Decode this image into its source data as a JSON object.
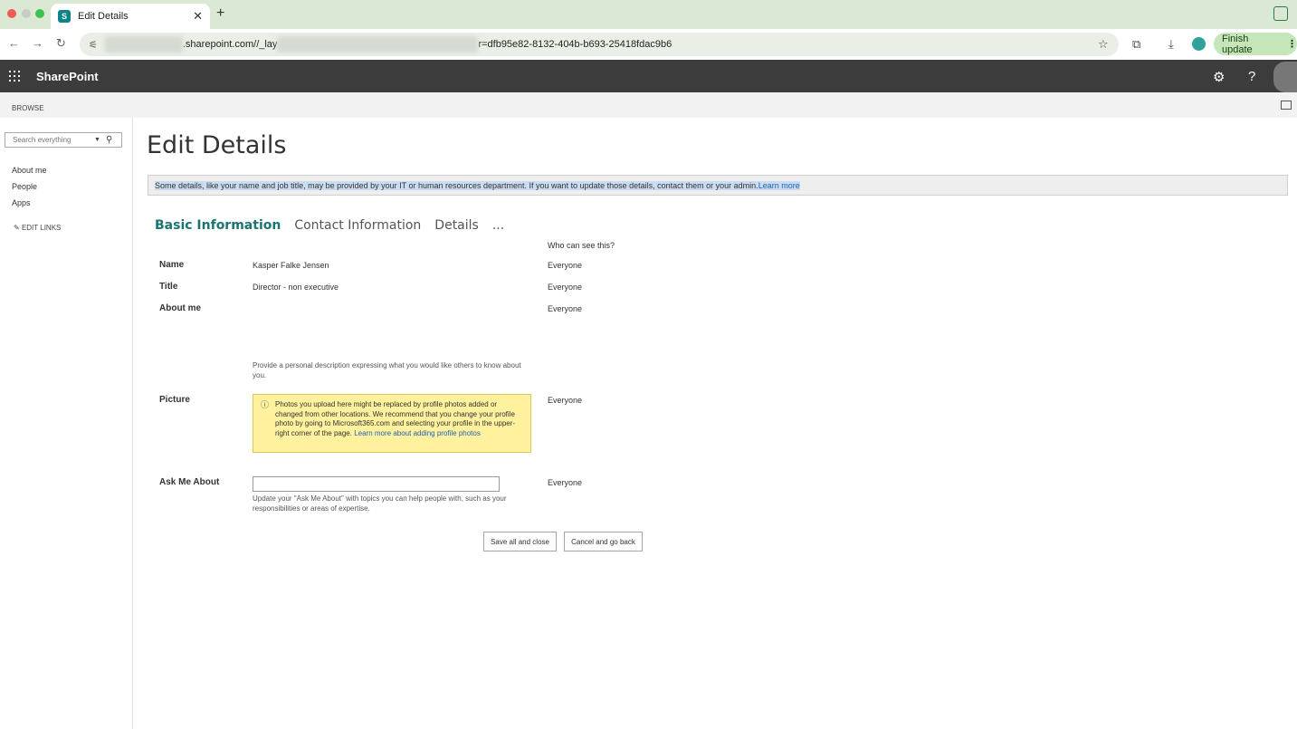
{
  "browser": {
    "tab_title": "Edit Details",
    "tab_favicon_letter": "S",
    "tab_close": "✕",
    "new_tab": "+",
    "url_visible_1": ".sharepoint.com//_lay",
    "url_visible_2": "r=dfb95e82-8132-404b-b693-25418fdac9b6",
    "finish_update": "Finish update",
    "nav_back": "←",
    "nav_forward": "→",
    "reload": "↻"
  },
  "suite": {
    "brand": "SharePoint",
    "settings_glyph": "⚙",
    "help_glyph": "?"
  },
  "ribbon": {
    "browse": "BROWSE"
  },
  "leftnav": {
    "search_placeholder": "Search everything",
    "items": [
      "About me",
      "People",
      "Apps"
    ],
    "edit_links": "EDIT LINKS"
  },
  "main": {
    "title": "Edit Details",
    "info_text": "Some details, like your name and job title, may be provided by your IT or human resources department. If you want to update those details, contact them or your admin.",
    "info_link": "Learn more",
    "tabs": [
      "Basic Information",
      "Contact Information",
      "Details"
    ],
    "tabs_more": "...",
    "who_can_see": "Who can see this?",
    "fields": {
      "name_label": "Name",
      "name_value": "Kasper Falke Jensen",
      "name_privacy": "Everyone",
      "title_label": "Title",
      "title_value": "Director - non executive",
      "title_privacy": "Everyone",
      "about_label": "About me",
      "about_privacy": "Everyone",
      "about_hint": "Provide a personal description expressing what you would like others to know about you.",
      "picture_label": "Picture",
      "picture_privacy": "Everyone",
      "picture_warning": "Photos you upload here might be replaced by profile photos added or changed from other locations. We recommend that you change your profile photo by going to Microsoft365.com and selecting your profile in the upper-right corner of the page.",
      "picture_link": "Learn more about adding profile photos",
      "ask_label": "Ask Me About",
      "ask_value": "",
      "ask_privacy": "Everyone",
      "ask_hint": "Update your \"Ask Me About\" with topics you can help people with, such as your responsibilities or areas of expertise."
    },
    "save_button": "Save all and close",
    "cancel_button": "Cancel and go back"
  },
  "colors": {
    "suite_bar": "#3c3c3c",
    "active_tab": "#1a7472",
    "warning_bg": "#fff19d",
    "link": "#1f62b5"
  }
}
